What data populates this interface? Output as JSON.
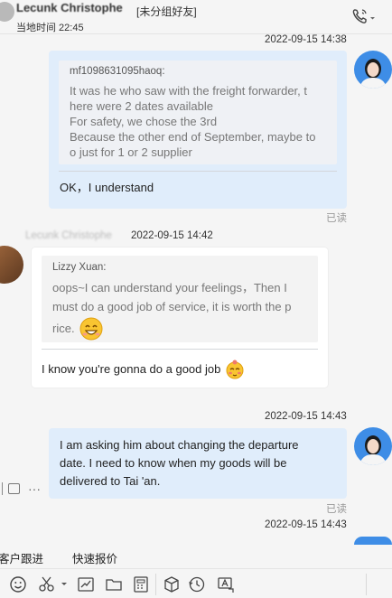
{
  "header": {
    "contact_name": "Lecunk Christophe",
    "group_label": "[未分组好友]",
    "local_time": "当地时间 22:45",
    "call_icon": "phone-call-icon"
  },
  "messages": {
    "m1": {
      "timestamp": "2022-09-15 14:38",
      "quote_author": "mf1098631095haoq:",
      "quote_lines": [
        "It was he who saw with the freight forwarder, t",
        "here were 2 dates available",
        "For safety, we chose the 3rd",
        "Because the other end of September, maybe to",
        "o just for 1 or 2 supplier"
      ],
      "text": "OK，I understand",
      "status": "已读"
    },
    "m2": {
      "sender": "Lecunk Christophe",
      "timestamp": "2022-09-15 14:42",
      "quote_author": "Lizzy Xuan:",
      "quote_lines": [
        "oops~I can understand your feelings，Then I",
        "must do a good job of service, it is worth the p",
        "rice."
      ],
      "text": "I know you're gonna do a good job"
    },
    "m3": {
      "timestamp": "2022-09-15 14:43",
      "lines": [
        "I am asking him about changing the departure",
        "date. I need to know when my goods will be",
        "delivered to Tai 'an."
      ],
      "status": "已读"
    },
    "m4": {
      "timestamp": "2022-09-15 14:43"
    }
  },
  "quick_actions": [
    "客户跟进",
    "快速报价"
  ],
  "toolbar": [
    "emoji-icon",
    "scissors-icon",
    "chart-icon",
    "folder-icon",
    "calculator-icon",
    "box-icon",
    "history-icon",
    "translate-icon"
  ],
  "colors": {
    "bubble_out": "#e0edfb",
    "bubble_in": "#ffffff",
    "background": "#f5f5f5"
  }
}
